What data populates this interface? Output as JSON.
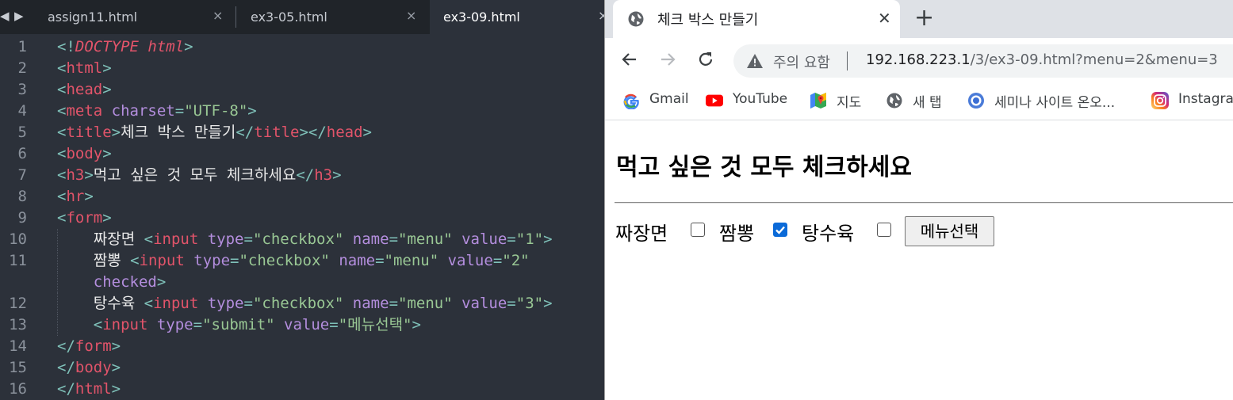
{
  "editor": {
    "tabs": [
      {
        "label": "assign11.html",
        "active": false
      },
      {
        "label": "ex3-05.html",
        "active": false
      },
      {
        "label": "ex3-09.html",
        "active": true
      }
    ],
    "close_glyph": "×",
    "lines": [
      {
        "num": "1",
        "segs": [
          [
            "p",
            "<!"
          ],
          [
            "d",
            "DOCTYPE html"
          ],
          [
            "p",
            ">"
          ]
        ]
      },
      {
        "num": "2",
        "segs": [
          [
            "p",
            "<"
          ],
          [
            "t",
            "html"
          ],
          [
            "p",
            ">"
          ]
        ]
      },
      {
        "num": "3",
        "segs": [
          [
            "p",
            "<"
          ],
          [
            "t",
            "head"
          ],
          [
            "p",
            ">"
          ]
        ]
      },
      {
        "num": "4",
        "segs": [
          [
            "p",
            "<"
          ],
          [
            "t",
            "meta "
          ],
          [
            "a",
            "charset"
          ],
          [
            "p",
            "="
          ],
          [
            "s",
            "\"UTF-8\""
          ],
          [
            "p",
            ">"
          ]
        ]
      },
      {
        "num": "5",
        "segs": [
          [
            "p",
            "<"
          ],
          [
            "t",
            "title"
          ],
          [
            "p",
            ">"
          ],
          [
            "x",
            "체크 박스 만들기"
          ],
          [
            "p",
            "</"
          ],
          [
            "t",
            "title"
          ],
          [
            "p",
            "></"
          ],
          [
            "t",
            "head"
          ],
          [
            "p",
            ">"
          ]
        ]
      },
      {
        "num": "6",
        "segs": [
          [
            "p",
            "<"
          ],
          [
            "t",
            "body"
          ],
          [
            "p",
            ">"
          ]
        ]
      },
      {
        "num": "7",
        "segs": [
          [
            "p",
            "<"
          ],
          [
            "t",
            "h3"
          ],
          [
            "p",
            ">"
          ],
          [
            "x",
            "먹고 싶은 것 모두 체크하세요"
          ],
          [
            "p",
            "</"
          ],
          [
            "t",
            "h3"
          ],
          [
            "p",
            ">"
          ]
        ]
      },
      {
        "num": "8",
        "segs": [
          [
            "p",
            "<"
          ],
          [
            "t",
            "hr"
          ],
          [
            "p",
            ">"
          ]
        ]
      },
      {
        "num": "9",
        "segs": [
          [
            "p",
            "<"
          ],
          [
            "t",
            "form"
          ],
          [
            "p",
            ">"
          ]
        ]
      },
      {
        "num": "10",
        "indent": true,
        "segs": [
          [
            "x",
            "    짜장면 "
          ],
          [
            "p",
            "<"
          ],
          [
            "t",
            "input "
          ],
          [
            "a",
            "type"
          ],
          [
            "p",
            "="
          ],
          [
            "s",
            "\"checkbox\" "
          ],
          [
            "a",
            "name"
          ],
          [
            "p",
            "="
          ],
          [
            "s",
            "\"menu\" "
          ],
          [
            "a",
            "value"
          ],
          [
            "p",
            "="
          ],
          [
            "s",
            "\"1\""
          ],
          [
            "p",
            ">"
          ]
        ]
      },
      {
        "num": "11",
        "indent": true,
        "segs": [
          [
            "x",
            "    짬뽕 "
          ],
          [
            "p",
            "<"
          ],
          [
            "t",
            "input "
          ],
          [
            "a",
            "type"
          ],
          [
            "p",
            "="
          ],
          [
            "s",
            "\"checkbox\" "
          ],
          [
            "a",
            "name"
          ],
          [
            "p",
            "="
          ],
          [
            "s",
            "\"menu\" "
          ],
          [
            "a",
            "value"
          ],
          [
            "p",
            "="
          ],
          [
            "s",
            "\"2\""
          ]
        ]
      },
      {
        "num": "",
        "indent": true,
        "segs": [
          [
            "x",
            "    "
          ],
          [
            "a",
            "checked"
          ],
          [
            "p",
            ">"
          ]
        ]
      },
      {
        "num": "12",
        "indent": true,
        "segs": [
          [
            "x",
            "    탕수육 "
          ],
          [
            "p",
            "<"
          ],
          [
            "t",
            "input "
          ],
          [
            "a",
            "type"
          ],
          [
            "p",
            "="
          ],
          [
            "s",
            "\"checkbox\" "
          ],
          [
            "a",
            "name"
          ],
          [
            "p",
            "="
          ],
          [
            "s",
            "\"menu\" "
          ],
          [
            "a",
            "value"
          ],
          [
            "p",
            "="
          ],
          [
            "s",
            "\"3\""
          ],
          [
            "p",
            ">"
          ]
        ]
      },
      {
        "num": "13",
        "indent": true,
        "segs": [
          [
            "x",
            "    "
          ],
          [
            "p",
            "<"
          ],
          [
            "t",
            "input "
          ],
          [
            "a",
            "type"
          ],
          [
            "p",
            "="
          ],
          [
            "s",
            "\"submit\" "
          ],
          [
            "a",
            "value"
          ],
          [
            "p",
            "="
          ],
          [
            "s",
            "\"메뉴선택\""
          ],
          [
            "p",
            ">"
          ]
        ]
      },
      {
        "num": "14",
        "segs": [
          [
            "p",
            "</"
          ],
          [
            "t",
            "form"
          ],
          [
            "p",
            ">"
          ]
        ]
      },
      {
        "num": "15",
        "segs": [
          [
            "p",
            "</"
          ],
          [
            "t",
            "body"
          ],
          [
            "p",
            ">"
          ]
        ]
      },
      {
        "num": "16",
        "segs": [
          [
            "p",
            "</"
          ],
          [
            "t",
            "html"
          ],
          [
            "p",
            ">"
          ]
        ]
      }
    ]
  },
  "browser": {
    "tab_title": "체크 박스 만들기",
    "tab_close": "✕",
    "new_tab": "+",
    "security_label": "주의 요함",
    "url_host": "192.168.223.1",
    "url_rest": "/3/ex3-09.html?menu=2&menu=3",
    "bookmarks": [
      {
        "label": "Gmail",
        "icon": "google-icon"
      },
      {
        "label": "YouTube",
        "icon": "youtube-icon"
      },
      {
        "label": "지도",
        "icon": "maps-icon"
      },
      {
        "label": "새 탭",
        "icon": "globe-icon"
      },
      {
        "label": "세미나 사이트 온오...",
        "icon": "chrome-icon"
      },
      {
        "label": "Instagram",
        "icon": "instagram-icon"
      }
    ],
    "page": {
      "heading": "먹고 싶은 것 모두 체크하세요",
      "options": [
        {
          "label": "짜장면",
          "checked": false
        },
        {
          "label": "짬뽕",
          "checked": true
        },
        {
          "label": "탕수육",
          "checked": false
        }
      ],
      "submit_label": "메뉴선택"
    }
  }
}
